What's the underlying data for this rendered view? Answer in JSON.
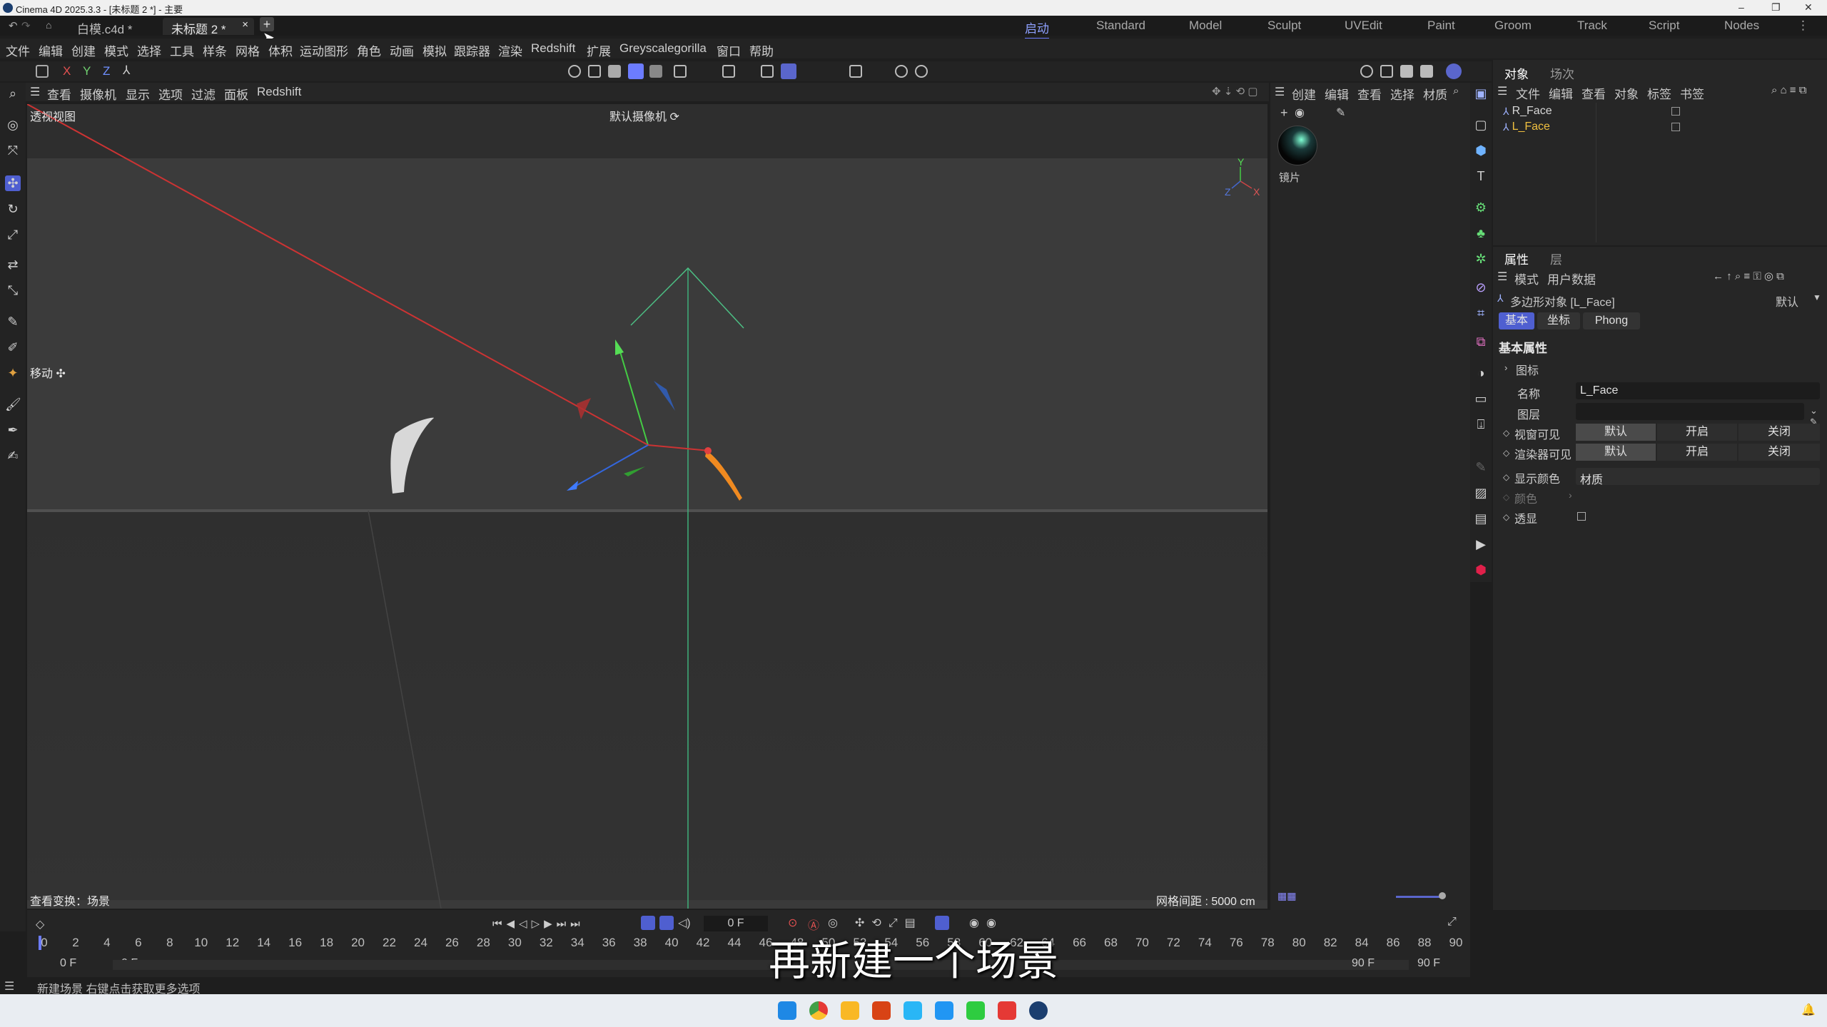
{
  "window": {
    "title": "Cinema 4D 2025.3.3 - [未标题 2 *] - 主要"
  },
  "tabs": {
    "doc1": "白模.c4d *",
    "doc2": "未标题 2 *",
    "close": "×",
    "add": "+"
  },
  "layouts": [
    "启动",
    "Standard",
    "Model",
    "Sculpt",
    "UVEdit",
    "Paint",
    "Groom",
    "Track",
    "Script",
    "Nodes"
  ],
  "menu": [
    "文件",
    "编辑",
    "创建",
    "模式",
    "选择",
    "工具",
    "样条",
    "网格",
    "体积",
    "运动图形",
    "角色",
    "动画",
    "模拟",
    "跟踪器",
    "渲染",
    "Redshift",
    "扩展",
    "Greyscalegorilla",
    "窗口",
    "帮助"
  ],
  "axis_buttons": [
    "X",
    "Y",
    "Z"
  ],
  "viewport_menu": [
    "查看",
    "摄像机",
    "显示",
    "选项",
    "过滤",
    "面板",
    "Redshift"
  ],
  "viewport": {
    "name": "透视视图",
    "camera": "默认摄像机 ⟳",
    "tool_label": "移动 ✣",
    "view_transform": "查看变换：场景",
    "grid_spacing": "网格间距 : 5000 cm"
  },
  "material_panel": {
    "menu": [
      "创建",
      "编辑",
      "查看",
      "选择",
      "材质"
    ],
    "material_name": "镜片"
  },
  "object_manager": {
    "tabs": [
      "对象",
      "场次"
    ],
    "menu": [
      "文件",
      "编辑",
      "查看",
      "对象",
      "标签",
      "书签"
    ],
    "objects": [
      {
        "name": "R_Face",
        "selected": false
      },
      {
        "name": "L_Face",
        "selected": true
      }
    ]
  },
  "attributes": {
    "tabs": [
      "属性",
      "层"
    ],
    "menu": [
      "模式",
      "用户数据"
    ],
    "object_type": "多边形对象 [L_Face]",
    "preset": "默认",
    "sub_tabs": [
      "基本",
      "坐标",
      "Phong"
    ],
    "section": "基本属性",
    "group": "图标",
    "name_label": "名称",
    "name_value": "L_Face",
    "layer_label": "图层",
    "vis_editor_label": "视窗可见",
    "vis_render_label": "渲染器可见",
    "tri_options": [
      "默认",
      "开启",
      "关闭"
    ],
    "display_color_label": "显示颜色",
    "display_color_value": "材质",
    "color_label": "颜色",
    "xray_label": "透显"
  },
  "timeline": {
    "current_frame": "0 F",
    "ticks": [
      "0",
      "2",
      "4",
      "6",
      "8",
      "10",
      "12",
      "14",
      "16",
      "18",
      "20",
      "22",
      "24",
      "26",
      "28",
      "30",
      "32",
      "34",
      "36",
      "38",
      "40",
      "42",
      "44",
      "46",
      "48",
      "50",
      "52",
      "54",
      "56",
      "58",
      "60",
      "62",
      "64",
      "66",
      "68",
      "70",
      "72",
      "74",
      "76",
      "78",
      "80",
      "82",
      "84",
      "86",
      "88",
      "90"
    ],
    "start_a": "0 F",
    "start_b": "0 F",
    "end_a": "90 F",
    "end_b": "90 F"
  },
  "status": {
    "text": "新建场景  右键点击获取更多选项"
  },
  "subtitle": "再新建一个场景",
  "colors": {
    "accent": "#6c7cff",
    "selected_object": "#f0c040",
    "gizmo_y": "#44cc44",
    "gizmo_x": "#cc3333",
    "gizmo_z": "#3366dd",
    "highlight_shape": "#f08a20"
  }
}
